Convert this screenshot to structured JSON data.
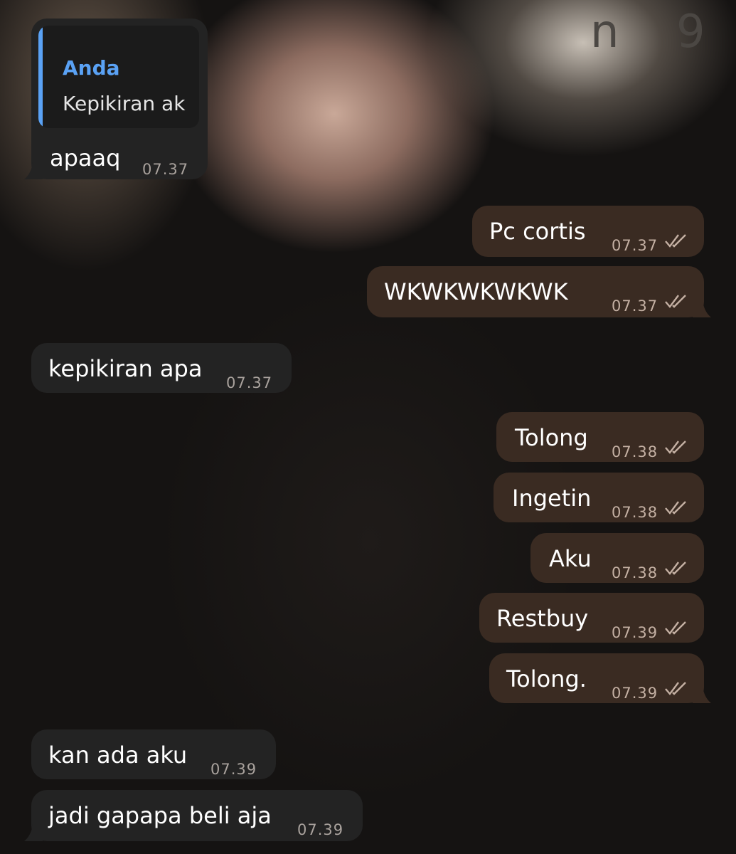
{
  "wallpaper": {
    "glyph_text": "n 9"
  },
  "reply": {
    "quote_name": "Anda",
    "quote_text": "Kepikiran ak",
    "text": "apaaq",
    "time": "07.37"
  },
  "messages": [
    {
      "direction": "out",
      "text": "Pc cortis",
      "time": "07.37",
      "read": true
    },
    {
      "direction": "out",
      "text": "WKWKWKWKWK",
      "time": "07.37",
      "read": true
    },
    {
      "direction": "in",
      "text": "kepikiran apa",
      "time": "07.37"
    },
    {
      "direction": "out",
      "text": "Tolong",
      "time": "07.38",
      "read": true
    },
    {
      "direction": "out",
      "text": "Ingetin",
      "time": "07.38",
      "read": true
    },
    {
      "direction": "out",
      "text": "Aku",
      "time": "07.38",
      "read": true
    },
    {
      "direction": "out",
      "text": "Restbuy",
      "time": "07.39",
      "read": true
    },
    {
      "direction": "out",
      "text": "Tolong.",
      "time": "07.39",
      "read": true
    },
    {
      "direction": "in",
      "text": "kan ada aku",
      "time": "07.39"
    },
    {
      "direction": "in",
      "text": "jadi gapapa beli aja",
      "time": "07.39"
    }
  ],
  "colors": {
    "incoming_bubble": "#232323",
    "outgoing_bubble": "#3a2b22",
    "quote_accent": "#5aa2f5",
    "read_ticks": "#c4b0a3"
  },
  "icons": {
    "read_receipt": "double-check-icon"
  }
}
